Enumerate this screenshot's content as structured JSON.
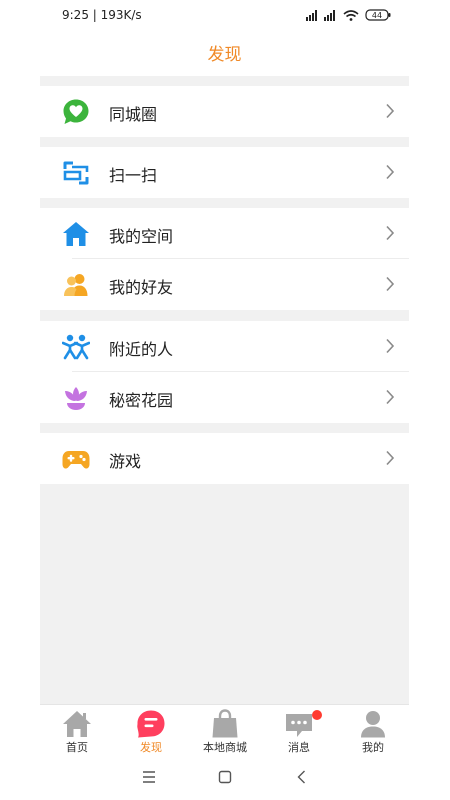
{
  "status_bar": {
    "time": "9:25 | 193K/s",
    "battery": "44"
  },
  "header": {
    "title": "发现"
  },
  "groups": [
    {
      "items": [
        {
          "label": "同城圈",
          "icon": "heart-chat-icon"
        }
      ]
    },
    {
      "items": [
        {
          "label": "扫一扫",
          "icon": "scan-icon"
        }
      ]
    },
    {
      "items": [
        {
          "label": "我的空间",
          "icon": "home-icon"
        },
        {
          "label": "我的好友",
          "icon": "friends-icon"
        }
      ]
    },
    {
      "items": [
        {
          "label": "附近的人",
          "icon": "nearby-people-icon"
        },
        {
          "label": "秘密花园",
          "icon": "lotus-icon"
        }
      ]
    },
    {
      "items": [
        {
          "label": "游戏",
          "icon": "gamepad-icon"
        }
      ]
    }
  ],
  "tabs": [
    {
      "label": "首页",
      "icon": "home-icon"
    },
    {
      "label": "发现",
      "icon": "discover-icon",
      "active": true
    },
    {
      "label": "本地商城",
      "icon": "shopping-bag-icon"
    },
    {
      "label": "消息",
      "icon": "message-icon",
      "badge": true
    },
    {
      "label": "我的",
      "icon": "profile-icon"
    }
  ],
  "colors": {
    "accent": "#f08a28",
    "green": "#3cb43c",
    "blue": "#1f8fe6",
    "orange": "#f5a623",
    "purple": "#c473e0",
    "badge": "#ff3b30"
  }
}
